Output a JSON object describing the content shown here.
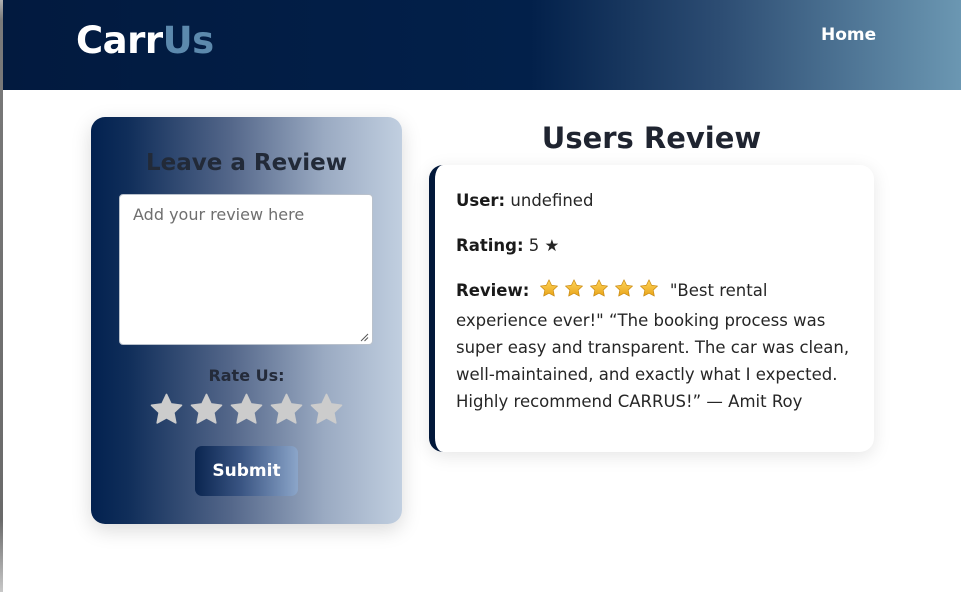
{
  "nav": {
    "brand_part1": "Carr",
    "brand_part2": "Us",
    "home_label": "Home"
  },
  "review_form": {
    "title": "Leave a Review",
    "placeholder": "Add your review here",
    "value": "",
    "rate_label": "Rate Us:",
    "rating_selected": 0,
    "rating_max": 5,
    "submit_label": "Submit"
  },
  "users_review": {
    "title": "Users Review",
    "items": [
      {
        "user_label": "User:",
        "user_value": "undefined",
        "rating_label": "Rating:",
        "rating_value": "5 ★",
        "review_label": "Review:",
        "review_stars": 5,
        "review_text": "\"Best rental experience ever!\" “The booking process was super easy and transparent. The car was clean, well-maintained, and exactly what I expected. Highly recommend CARRUS!” — Amit Roy"
      }
    ]
  },
  "colors": {
    "navy": "#02204a",
    "brand_accent": "#5c89ad",
    "star_empty": "#cccccc",
    "star_filled": "#f2b51c"
  },
  "icons": {
    "rate_star": "star-icon",
    "review_star": "star-emoji-icon",
    "resize": "resize-handle-icon"
  }
}
